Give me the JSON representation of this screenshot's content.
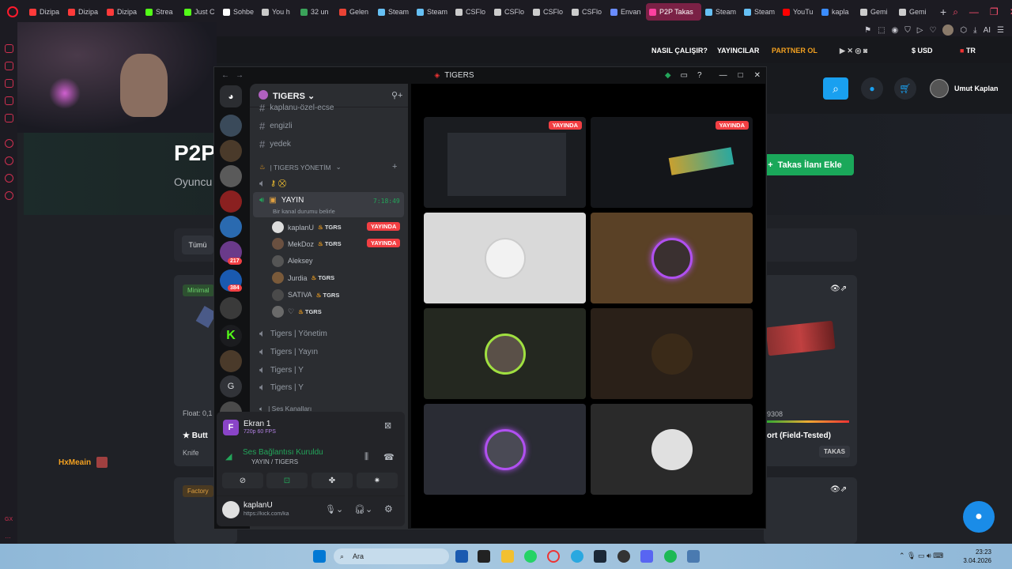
{
  "browser": {
    "tabs": [
      "Dizipa",
      "Dizipa",
      "Dizipa",
      "Strea",
      "Just C",
      "Sohbe",
      "You h",
      "32 un",
      "Gelen",
      "Steam",
      "Steam",
      "CSFlo",
      "CSFlo",
      "CSFlo",
      "CSFlo",
      "Envan",
      "P2P Takas",
      "Steam",
      "Steam",
      "YouTu",
      "kapla",
      "Gemi",
      "Gemi"
    ],
    "tab_colors": [
      "#ff3a3a",
      "#ff3a3a",
      "#ff3a3a",
      "#53fc18",
      "#53fc18",
      "#ffffff",
      "#c9c9c9",
      "#3aa35a",
      "#ea4335",
      "#66c0f4",
      "#66c0f4",
      "#cccccc",
      "#cccccc",
      "#cccccc",
      "#cccccc",
      "#6a8cff",
      "#ff40a0",
      "#66c0f4",
      "#66c0f4",
      "#ff0000",
      "#3a8cff",
      "#cccccc",
      "#cccccc"
    ],
    "active_tab_index": 16,
    "toolbar_ai": "AI"
  },
  "site": {
    "nav": {
      "how": "NASIL ÇALIŞIR?",
      "streamers": "YAYINCILAR",
      "partner": "PARTNER OL",
      "currency": "$ USD",
      "lang": "TR"
    },
    "user_name": "Umut Kaplan",
    "hero_title": "P2P",
    "hero_sub": "Oyuncu",
    "add_trade": "Takas İlanı Ekle",
    "filter_all": "Tümü",
    "card1": {
      "tag": "Minimal",
      "float": "Float: 0,1",
      "name": "★ Butt",
      "type": "Knife"
    },
    "card2": {
      "num": "9308",
      "name": "ort (Field-Tested)",
      "action": "TAKAS"
    },
    "card3_tag": "Factory",
    "chat_user": "HxMeain"
  },
  "discord": {
    "window_title": "TIGERS",
    "server_name": "TIGERS",
    "channels_top": [
      "kaplanu-özel-ecse",
      "engizli",
      "yedek"
    ],
    "category1": "| TIGERS YÖNETİM",
    "voice_active": "YAYIN",
    "voice_time": "7:18:49",
    "voice_status": "Bir kanal durumu belirle",
    "members": [
      {
        "name": "kaplanU",
        "tag": "TGRS",
        "live": "YAYINDA"
      },
      {
        "name": "MekDoz",
        "tag": "TGRS",
        "live": "YAYINDA"
      },
      {
        "name": "Aleksey",
        "tag": "",
        "live": ""
      },
      {
        "name": "Jurdia",
        "tag": "TGRS",
        "live": ""
      },
      {
        "name": "SATIVA",
        "tag": "TGRS",
        "live": ""
      },
      {
        "name": "♡",
        "tag": "TGRS",
        "live": ""
      }
    ],
    "voice_channels": [
      "Tigers | Yönetim",
      "Tigers | Yayın",
      "Tigers | Y",
      "Tigers | Y"
    ],
    "category2": "| Ses Kanalları",
    "badges": [
      "217",
      "384"
    ],
    "guild_letter": "G",
    "screen": {
      "title": "Ekran 1",
      "quality": "720p 60 FPS"
    },
    "connection": {
      "status": "Ses Bağlantısı Kuruldu",
      "channel": "YAYIN / TIGERS"
    },
    "self": {
      "name": "kaplanU",
      "status": "https://kick.com/ka"
    },
    "live_label": "YAYINDA"
  },
  "taskbar": {
    "search": "Ara",
    "time": "23:23",
    "date": "3.04.2026"
  },
  "colors": {
    "accent_blue": "#19a0f0",
    "discord_green": "#23a55a",
    "live_red": "#f23f43",
    "trade_green": "#1aa85a"
  }
}
